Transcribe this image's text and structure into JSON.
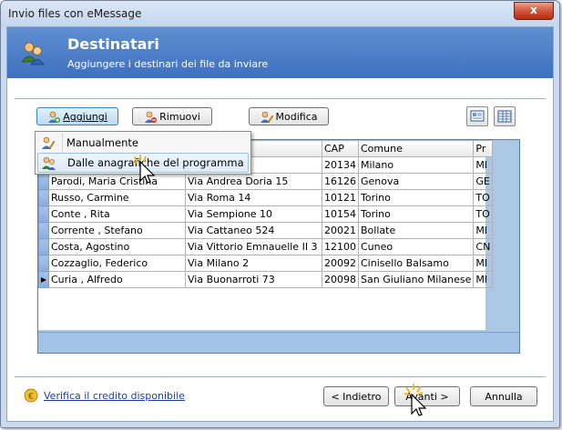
{
  "window": {
    "title": "Invio files con eMessage",
    "close_glyph": "x"
  },
  "banner": {
    "title": "Destinatari",
    "subtitle": "Aggiungere i destinari dei file da inviare",
    "icon": "contacts-icon"
  },
  "toolbar": {
    "add": "Aggiungi",
    "remove": "Rimuovi",
    "edit": "Modifica"
  },
  "menu": {
    "items": [
      "Manualmente",
      "Dalle anagrafiche del programma"
    ]
  },
  "table": {
    "headers": {
      "cap": "CAP",
      "comune": "Comune",
      "pr": "Pr"
    },
    "rows": [
      {
        "name": "",
        "address": "",
        "cap": "20134",
        "comune": "Milano",
        "pr": "MI"
      },
      {
        "name": "Parodi, Maria Cristina",
        "address": "Via Andrea Doria 15",
        "cap": "16126",
        "comune": "Genova",
        "pr": "GE"
      },
      {
        "name": "Russo, Carmine",
        "address": "Via Roma 14",
        "cap": "10121",
        "comune": "Torino",
        "pr": "TO"
      },
      {
        "name": "Conte , Rita",
        "address": "Via Sempione 10",
        "cap": "10154",
        "comune": "Torino",
        "pr": "TO"
      },
      {
        "name": "Corrente , Stefano",
        "address": "Via Cattaneo 524",
        "cap": "20021",
        "comune": "Bollate",
        "pr": "MI"
      },
      {
        "name": "Costa, Agostino",
        "address": "Via Vittorio Emnauelle II 3",
        "cap": "12100",
        "comune": "Cuneo",
        "pr": "CN"
      },
      {
        "name": "Cozzaglio, Federico",
        "address": "Via Milano 2",
        "cap": "20092",
        "comune": "Cinisello Balsamo",
        "pr": "MI"
      },
      {
        "name": "Curia , Alfredo",
        "address": "Via Buonarroti 73",
        "cap": "20098",
        "comune": "San Giuliano Milanese",
        "pr": "MI"
      }
    ],
    "current_row_marker": "▶"
  },
  "footer": {
    "credit_link": "Verifica il credito disponibile",
    "back": "< Indietro",
    "next": "Avanti >",
    "cancel": "Annulla"
  }
}
